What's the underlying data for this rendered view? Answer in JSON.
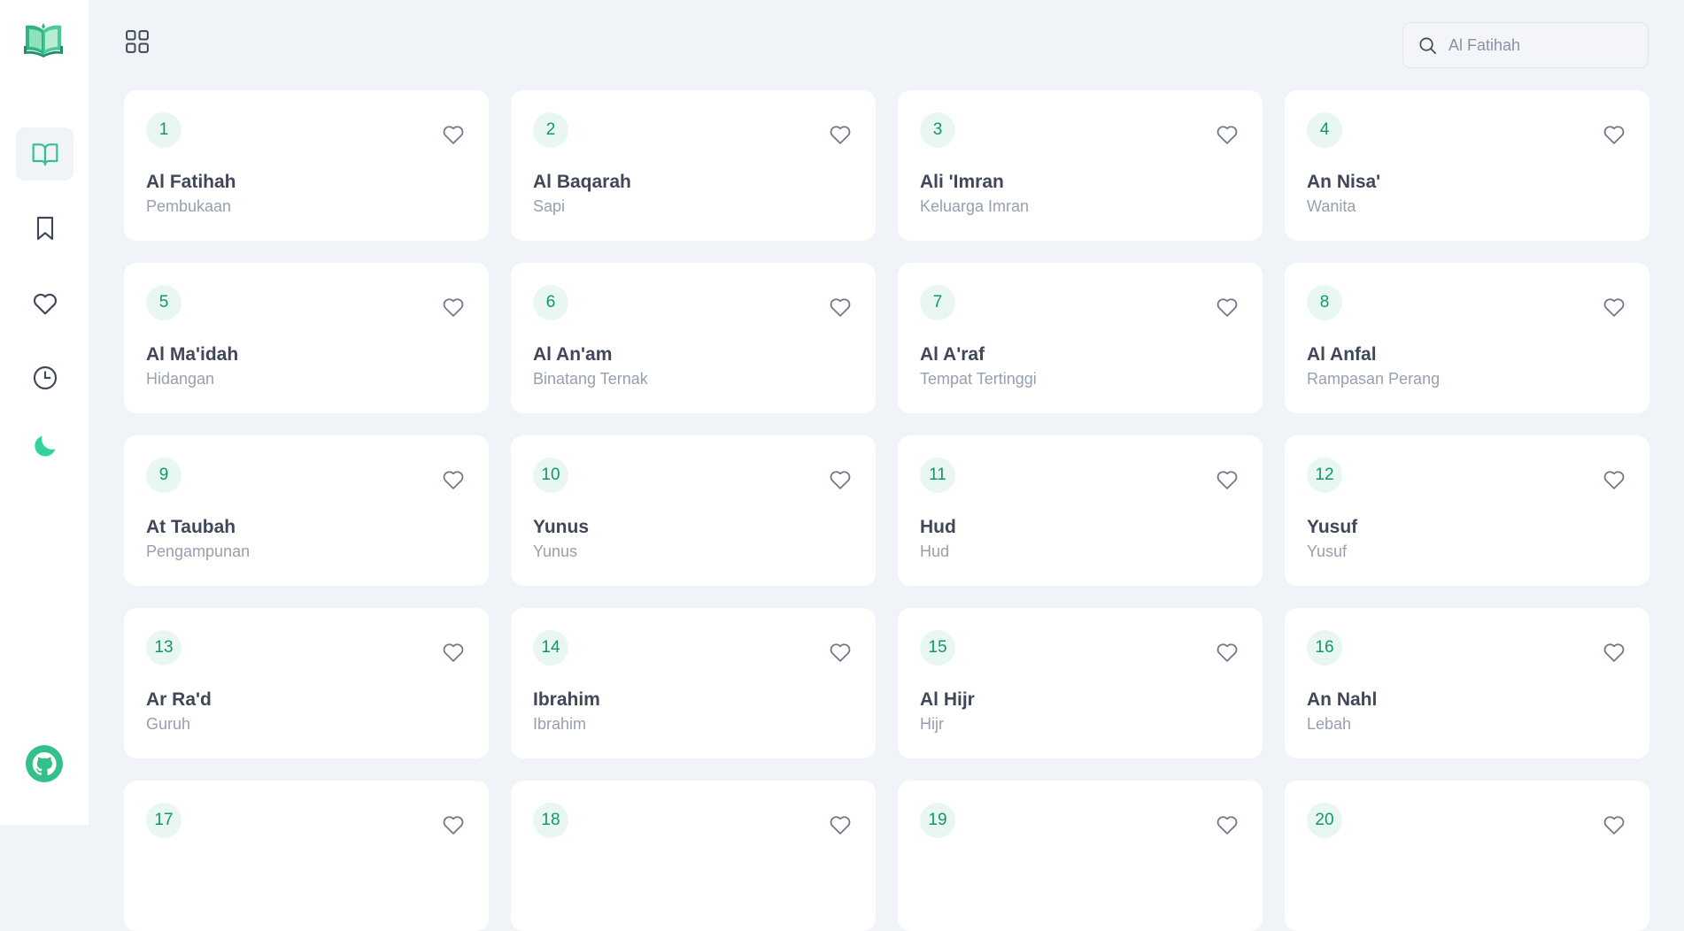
{
  "search": {
    "placeholder": "Al Fatihah"
  },
  "colors": {
    "accent": "#12966b",
    "accent_light": "#e8f8f0",
    "moon": "#34d399",
    "background": "#f0f3f7"
  },
  "sidebar": {
    "items": [
      {
        "icon": "open-book-icon",
        "active": true
      },
      {
        "icon": "bookmark-icon",
        "active": false
      },
      {
        "icon": "heart-icon",
        "active": false
      },
      {
        "icon": "clock-icon",
        "active": false
      },
      {
        "icon": "moon-icon",
        "active": false
      }
    ],
    "footer_icon": "github-icon"
  },
  "surahs": [
    {
      "number": "1",
      "name": "Al Fatihah",
      "meaning": "Pembukaan"
    },
    {
      "number": "2",
      "name": "Al Baqarah",
      "meaning": "Sapi"
    },
    {
      "number": "3",
      "name": "Ali 'Imran",
      "meaning": "Keluarga Imran"
    },
    {
      "number": "4",
      "name": "An Nisa'",
      "meaning": "Wanita"
    },
    {
      "number": "5",
      "name": "Al Ma'idah",
      "meaning": "Hidangan"
    },
    {
      "number": "6",
      "name": "Al An'am",
      "meaning": "Binatang Ternak"
    },
    {
      "number": "7",
      "name": "Al A'raf",
      "meaning": "Tempat Tertinggi"
    },
    {
      "number": "8",
      "name": "Al Anfal",
      "meaning": "Rampasan Perang"
    },
    {
      "number": "9",
      "name": "At Taubah",
      "meaning": "Pengampunan"
    },
    {
      "number": "10",
      "name": "Yunus",
      "meaning": "Yunus"
    },
    {
      "number": "11",
      "name": "Hud",
      "meaning": "Hud"
    },
    {
      "number": "12",
      "name": "Yusuf",
      "meaning": "Yusuf"
    },
    {
      "number": "13",
      "name": "Ar Ra'd",
      "meaning": "Guruh"
    },
    {
      "number": "14",
      "name": "Ibrahim",
      "meaning": "Ibrahim"
    },
    {
      "number": "15",
      "name": "Al Hijr",
      "meaning": "Hijr"
    },
    {
      "number": "16",
      "name": "An Nahl",
      "meaning": "Lebah"
    },
    {
      "number": "17",
      "name": "",
      "meaning": ""
    },
    {
      "number": "18",
      "name": "",
      "meaning": ""
    },
    {
      "number": "19",
      "name": "",
      "meaning": ""
    },
    {
      "number": "20",
      "name": "",
      "meaning": ""
    }
  ]
}
